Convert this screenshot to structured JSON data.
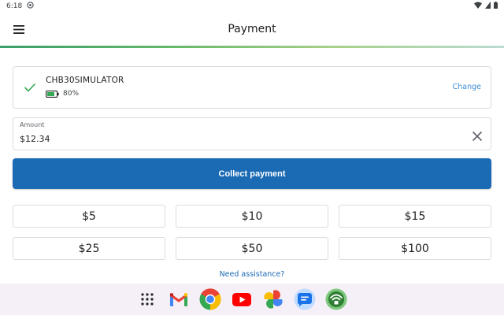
{
  "status_bar": {
    "time": "6:18"
  },
  "app_bar": {
    "title": "Payment"
  },
  "reader": {
    "name": "CHB30SIMULATOR",
    "battery_label": "80%",
    "battery_level": 0.8,
    "change_label": "Change"
  },
  "amount": {
    "label": "Amount",
    "value": "$12.34"
  },
  "collect": {
    "label": "Collect payment"
  },
  "quick_amounts": [
    "$5",
    "$10",
    "$15",
    "$25",
    "$50",
    "$100"
  ],
  "assistance": {
    "label": "Need assistance?"
  },
  "colors": {
    "primary": "#1a6ab4",
    "link": "#3b8bd1",
    "success": "#34a853"
  },
  "dock_apps": [
    "app-drawer-icon",
    "gmail-icon",
    "chrome-icon",
    "youtube-icon",
    "photos-icon",
    "messages-icon",
    "wifi-app-icon"
  ]
}
